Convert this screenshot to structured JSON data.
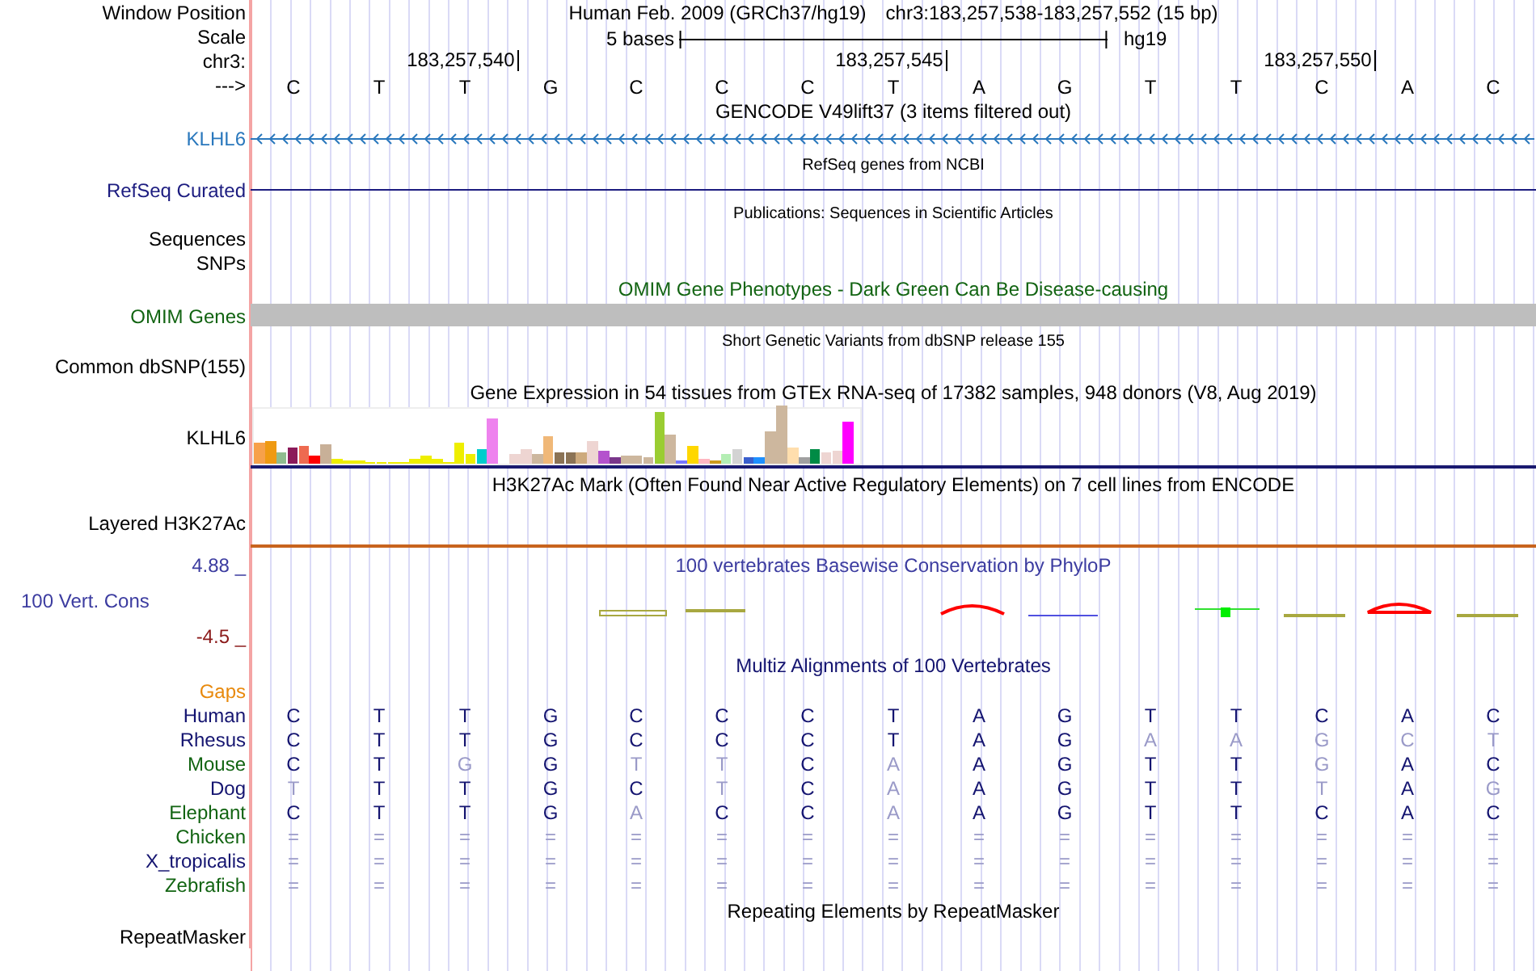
{
  "header": {
    "position_label": "Window Position",
    "assembly_title": "Human Feb. 2009 (GRCh37/hg19)",
    "position_title": "chr3:183,257,538-183,257,552 (15 bp)",
    "scale_label": "Scale",
    "scale_text": "5 bases",
    "scale_assembly": "hg19",
    "chrom_label": "chr3:",
    "ticks": [
      "183,257,540",
      "183,257,545",
      "183,257,550"
    ],
    "strand_label": "--->",
    "bases": [
      "C",
      "T",
      "T",
      "G",
      "C",
      "C",
      "C",
      "T",
      "A",
      "G",
      "T",
      "T",
      "C",
      "A",
      "C"
    ]
  },
  "tracks": [
    {
      "kind": "title",
      "text": "GENCODE V49lift37 (3 items filtered out)"
    },
    {
      "kind": "gene",
      "label": "KLHL6",
      "color": "#2a78bd"
    },
    {
      "kind": "note",
      "text": "RefSeq genes from NCBI"
    },
    {
      "kind": "line",
      "label": "RefSeq Curated",
      "color": "#1c1c80"
    },
    {
      "kind": "note",
      "text": "Publications: Sequences in Scientific Articles"
    },
    {
      "kind": "label",
      "label": "Sequences"
    },
    {
      "kind": "label",
      "label": "SNPs"
    },
    {
      "kind": "title",
      "text": "OMIM Gene Phenotypes - Dark Green Can Be Disease-causing",
      "color": "#126412"
    },
    {
      "kind": "bar",
      "label": "OMIM Genes",
      "color": "#126412"
    },
    {
      "kind": "note",
      "text": "Short Genetic Variants from dbSNP release 155"
    },
    {
      "kind": "label",
      "label": "Common dbSNP(155)"
    },
    {
      "kind": "title",
      "text": "Gene Expression in 54 tissues from GTEx RNA-seq of 17382 samples, 948 donors (V8, Aug 2019)"
    },
    {
      "kind": "expression",
      "label": "KLHL6"
    },
    {
      "kind": "title",
      "text": "H3K27Ac Mark (Often Found Near Active Regulatory Elements) on 7 cell lines from ENCODE"
    },
    {
      "kind": "layered",
      "label": "Layered H3K27Ac"
    },
    {
      "kind": "conservation",
      "title": "100 vertebrates Basewise Conservation by PhyloP",
      "label": "100 Vert. Cons",
      "max": "4.88 _",
      "min": "-4.5 _"
    },
    {
      "kind": "title",
      "text": "Multiz Alignments of 100 Vertebrates",
      "color": "#141470"
    },
    {
      "kind": "label",
      "label": "Gaps",
      "color": "#e8890c"
    },
    {
      "kind": "alignment",
      "species": [
        {
          "name": "Human",
          "color": "#141470",
          "bases": [
            {
              "b": "C",
              "match": true
            },
            {
              "b": "T",
              "match": true
            },
            {
              "b": "T",
              "match": true
            },
            {
              "b": "G",
              "match": true
            },
            {
              "b": "C",
              "match": true
            },
            {
              "b": "C",
              "match": true
            },
            {
              "b": "C",
              "match": true
            },
            {
              "b": "T",
              "match": true
            },
            {
              "b": "A",
              "match": true
            },
            {
              "b": "G",
              "match": true
            },
            {
              "b": "T",
              "match": true
            },
            {
              "b": "T",
              "match": true
            },
            {
              "b": "C",
              "match": true
            },
            {
              "b": "A",
              "match": true
            },
            {
              "b": "C",
              "match": true
            }
          ]
        },
        {
          "name": "Rhesus",
          "color": "#141470",
          "bases": [
            {
              "b": "C",
              "match": true
            },
            {
              "b": "T",
              "match": true
            },
            {
              "b": "T",
              "match": true
            },
            {
              "b": "G",
              "match": true
            },
            {
              "b": "C",
              "match": true
            },
            {
              "b": "C",
              "match": true
            },
            {
              "b": "C",
              "match": true
            },
            {
              "b": "T",
              "match": true
            },
            {
              "b": "A",
              "match": true
            },
            {
              "b": "G",
              "match": true
            },
            {
              "b": "A",
              "match": false
            },
            {
              "b": "A",
              "match": false
            },
            {
              "b": "G",
              "match": false
            },
            {
              "b": "C",
              "match": false
            },
            {
              "b": "T",
              "match": false
            }
          ]
        },
        {
          "name": "Mouse",
          "color": "#126412",
          "bases": [
            {
              "b": "C",
              "match": true
            },
            {
              "b": "T",
              "match": true
            },
            {
              "b": "G",
              "match": false
            },
            {
              "b": "G",
              "match": true
            },
            {
              "b": "T",
              "match": false
            },
            {
              "b": "T",
              "match": false
            },
            {
              "b": "C",
              "match": true
            },
            {
              "b": "A",
              "match": false
            },
            {
              "b": "A",
              "match": true
            },
            {
              "b": "G",
              "match": true
            },
            {
              "b": "T",
              "match": true
            },
            {
              "b": "T",
              "match": true
            },
            {
              "b": "G",
              "match": false
            },
            {
              "b": "A",
              "match": true
            },
            {
              "b": "C",
              "match": true
            }
          ]
        },
        {
          "name": "Dog",
          "color": "#141470",
          "bases": [
            {
              "b": "T",
              "match": false
            },
            {
              "b": "T",
              "match": true
            },
            {
              "b": "T",
              "match": true
            },
            {
              "b": "G",
              "match": true
            },
            {
              "b": "C",
              "match": true
            },
            {
              "b": "T",
              "match": false
            },
            {
              "b": "C",
              "match": true
            },
            {
              "b": "A",
              "match": false
            },
            {
              "b": "A",
              "match": true
            },
            {
              "b": "G",
              "match": true
            },
            {
              "b": "T",
              "match": true
            },
            {
              "b": "T",
              "match": true
            },
            {
              "b": "T",
              "match": false
            },
            {
              "b": "A",
              "match": true
            },
            {
              "b": "G",
              "match": false
            }
          ]
        },
        {
          "name": "Elephant",
          "color": "#126412",
          "bases": [
            {
              "b": "C",
              "match": true
            },
            {
              "b": "T",
              "match": true
            },
            {
              "b": "T",
              "match": true
            },
            {
              "b": "G",
              "match": true
            },
            {
              "b": "A",
              "match": false
            },
            {
              "b": "C",
              "match": true
            },
            {
              "b": "C",
              "match": true
            },
            {
              "b": "A",
              "match": false
            },
            {
              "b": "A",
              "match": true
            },
            {
              "b": "G",
              "match": true
            },
            {
              "b": "T",
              "match": true
            },
            {
              "b": "T",
              "match": true
            },
            {
              "b": "C",
              "match": true
            },
            {
              "b": "A",
              "match": true
            },
            {
              "b": "C",
              "match": true
            }
          ]
        },
        {
          "name": "Chicken",
          "color": "#126412",
          "bases": [
            {
              "b": "=",
              "match": false
            },
            {
              "b": "=",
              "match": false
            },
            {
              "b": "=",
              "match": false
            },
            {
              "b": "=",
              "match": false
            },
            {
              "b": "=",
              "match": false
            },
            {
              "b": "=",
              "match": false
            },
            {
              "b": "=",
              "match": false
            },
            {
              "b": "=",
              "match": false
            },
            {
              "b": "=",
              "match": false
            },
            {
              "b": "=",
              "match": false
            },
            {
              "b": "=",
              "match": false
            },
            {
              "b": "=",
              "match": false
            },
            {
              "b": "=",
              "match": false
            },
            {
              "b": "=",
              "match": false
            },
            {
              "b": "=",
              "match": false
            }
          ]
        },
        {
          "name": "X_tropicalis",
          "color": "#141470",
          "bases": [
            {
              "b": "=",
              "match": false
            },
            {
              "b": "=",
              "match": false
            },
            {
              "b": "=",
              "match": false
            },
            {
              "b": "=",
              "match": false
            },
            {
              "b": "=",
              "match": false
            },
            {
              "b": "=",
              "match": false
            },
            {
              "b": "=",
              "match": false
            },
            {
              "b": "=",
              "match": false
            },
            {
              "b": "=",
              "match": false
            },
            {
              "b": "=",
              "match": false
            },
            {
              "b": "=",
              "match": false
            },
            {
              "b": "=",
              "match": false
            },
            {
              "b": "=",
              "match": false
            },
            {
              "b": "=",
              "match": false
            },
            {
              "b": "=",
              "match": false
            }
          ]
        },
        {
          "name": "Zebrafish",
          "color": "#126412",
          "bases": [
            {
              "b": "=",
              "match": false
            },
            {
              "b": "=",
              "match": false
            },
            {
              "b": "=",
              "match": false
            },
            {
              "b": "=",
              "match": false
            },
            {
              "b": "=",
              "match": false
            },
            {
              "b": "=",
              "match": false
            },
            {
              "b": "=",
              "match": false
            },
            {
              "b": "=",
              "match": false
            },
            {
              "b": "=",
              "match": false
            },
            {
              "b": "=",
              "match": false
            },
            {
              "b": "=",
              "match": false
            },
            {
              "b": "=",
              "match": false
            },
            {
              "b": "=",
              "match": false
            },
            {
              "b": "=",
              "match": false
            },
            {
              "b": "=",
              "match": false
            }
          ]
        }
      ]
    },
    {
      "kind": "title",
      "text": "Repeating Elements by RepeatMasker"
    },
    {
      "kind": "label",
      "label": "RepeatMasker"
    }
  ]
}
